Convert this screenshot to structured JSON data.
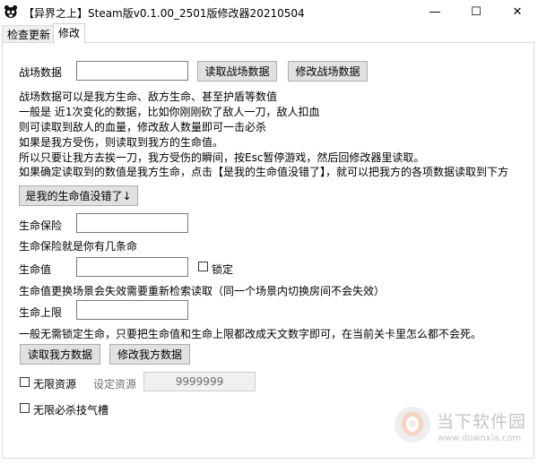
{
  "window": {
    "title": "【异界之上】Steam版v0.1.00_2501版修改器20210504",
    "minimize_glyph": "—",
    "maximize_glyph": "☐",
    "close_glyph": "✕",
    "icon": "panda-app-icon"
  },
  "tabs": [
    {
      "label": "检查更新",
      "active": false
    },
    {
      "label": "修改",
      "active": true
    }
  ],
  "battle": {
    "label": "战场数据",
    "value": "",
    "read_button": "读取战场数据",
    "modify_button": "修改战场数据"
  },
  "info_lines": [
    "战场数据可以是我方生命、敌方生命、甚至护盾等数值",
    "一般是    近1次变化的数据，比如你刚刚砍了敌人一刀，敌人扣血",
    "则可读取到敌人的血量，修改敌人数量即可一击必杀",
    "如果是我方受伤，则读取到我方的生命值。",
    "所以只要让我方去挨一刀，我方受伤的瞬间，按Esc暂停游戏，然后回修改器里读取。",
    "如果确定读取到的数值是我方生命，点击【是我的生命值没错了】，就可以把我方的各项数据读取到下方"
  ],
  "confirm_button": "是我的生命值没错了↓",
  "life_insurance": {
    "label": "生命保险",
    "value": "",
    "note": "生命保险就是你有几条命"
  },
  "hp": {
    "label": "生命值",
    "value": "",
    "lock_label": "锁定",
    "locked": false,
    "note": "生命值更换场景会失效需要重新检索读取（同一个场景内切换房间不会失效）"
  },
  "hp_max": {
    "label": "生命上限",
    "value": "",
    "note": "一般无需锁定生命，只要把生命值和生命上限都改成天文数字即可，在当前关卡里怎么都不会死。"
  },
  "our_buttons": {
    "read": "读取我方数据",
    "modify": "修改我方数据"
  },
  "resources": {
    "checkbox_label": "无限资源",
    "checked": false,
    "set_label": "设定资源",
    "set_value": "9999999"
  },
  "ultimate": {
    "checkbox_label": "无限必杀技气槽",
    "checked": false
  },
  "watermark": {
    "name": "当下软件园",
    "url": "www.downxia.com"
  }
}
